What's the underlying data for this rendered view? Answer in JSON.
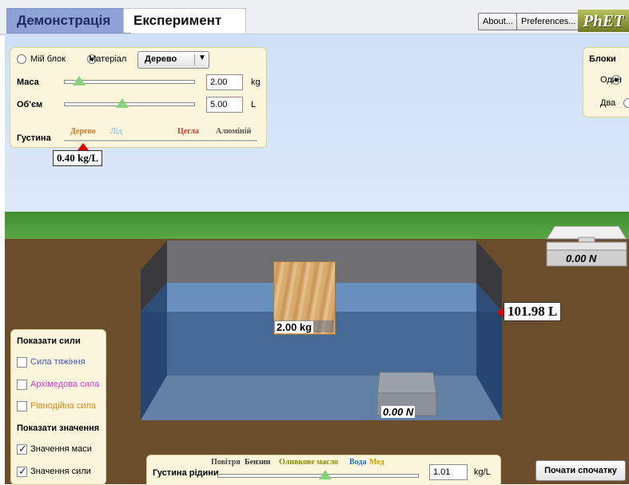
{
  "tabs": {
    "demo": "Демонстрація",
    "experiment": "Експеримент"
  },
  "top": {
    "about": "About...",
    "preferences": "Preferences...",
    "logo": "PhET"
  },
  "material_panel": {
    "my_block": "Мій блок",
    "material": "Матеріал",
    "material_value": "Дерево",
    "mass_label": "Маса",
    "mass_value": "2.00",
    "mass_unit": "kg",
    "volume_label": "Об'єм",
    "volume_value": "5.00",
    "volume_unit": "L",
    "density_label": "Густина",
    "density_marks": [
      "Дерево",
      "Лід",
      "Цегла",
      "Алюміній"
    ],
    "density_readout": "0.40 kg/L"
  },
  "blocks_panel": {
    "title": "Блоки",
    "one": "Один",
    "two": "Два"
  },
  "scene": {
    "block_mass": "2.00 kg",
    "scale_right": "0.00 N",
    "scale_bottom": "0.00 N",
    "volume": "101.98 L"
  },
  "forces_panel": {
    "show_forces": "Показати сили",
    "gravity": "Сила тяжіння",
    "buoyancy": "Архімедова сила",
    "contact": "Рівнодійна сила",
    "show_values": "Показати значення",
    "mass_values": "Значення маси",
    "force_values": "Значення сили"
  },
  "fluid_panel": {
    "label": "Густина рідини",
    "marks": [
      "Повітря",
      "Бензин",
      "Оливкове масло",
      "Вода",
      "Мед"
    ],
    "value": "1.01",
    "unit": "kg/L"
  },
  "reset": "Почати спочатку",
  "colors": {
    "wood": "#c87a2a",
    "ice": "#6ab0e6",
    "brick": "#d23b2b",
    "aluminum": "#555555",
    "gravity": "#3a56c8",
    "buoyancy": "#d63ad6",
    "contact": "#e08a1a"
  }
}
